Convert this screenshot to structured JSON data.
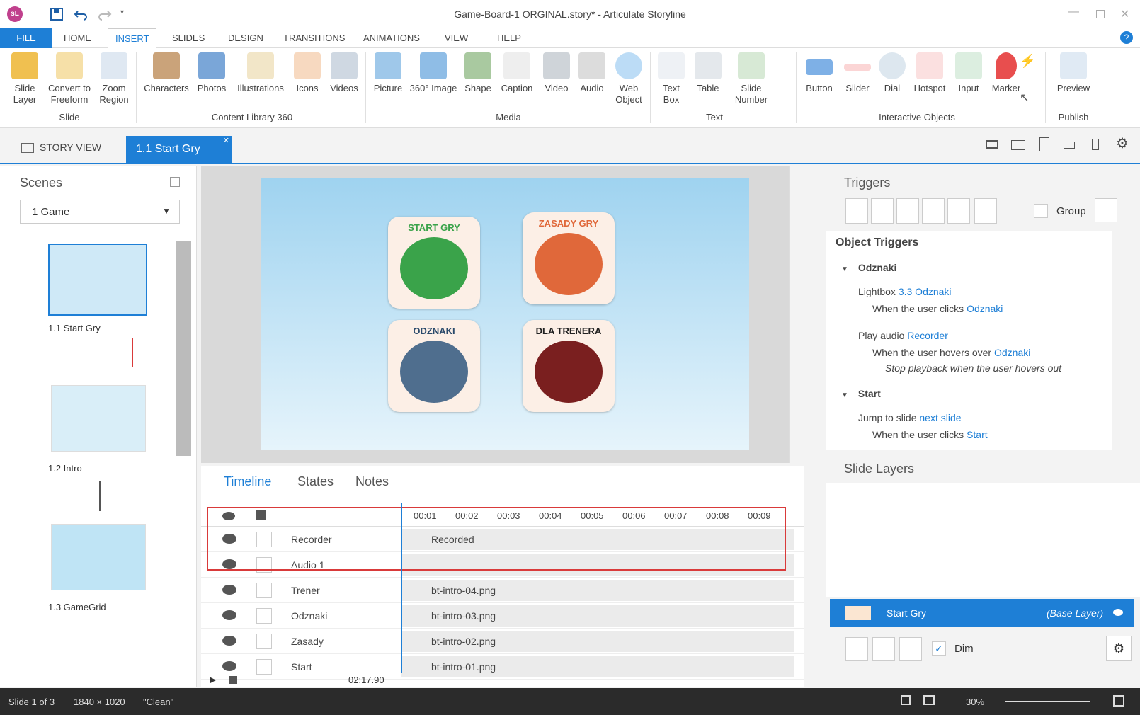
{
  "title": "Game-Board-1 ORGINAL.story* -  Articulate Storyline",
  "app_logo": "sL",
  "colors": {
    "accent": "#1e7fd6",
    "highlight_box": "#d93a3a"
  },
  "menu": {
    "file": "FILE",
    "items": [
      "HOME",
      "INSERT",
      "SLIDES",
      "DESIGN",
      "TRANSITIONS",
      "ANIMATIONS",
      "VIEW",
      "HELP"
    ],
    "active": "INSERT"
  },
  "ribbon": {
    "slide": {
      "layer": "Slide\nLayer",
      "freeform": "Convert to\nFreeform",
      "zoom": "Zoom\nRegion",
      "group": "Slide"
    },
    "library": {
      "characters": "Characters",
      "photos": "Photos",
      "illustrations": "Illustrations",
      "icons": "Icons",
      "videos": "Videos",
      "group": "Content Library 360"
    },
    "media": {
      "picture": "Picture",
      "image360": "360° Image",
      "shape": "Shape",
      "caption": "Caption",
      "video": "Video",
      "audio": "Audio",
      "web": "Web\nObject",
      "group": "Media"
    },
    "text": {
      "textbox": "Text\nBox",
      "table": "Table",
      "slidenumber": "Slide\nNumber",
      "group": "Text"
    },
    "interactive": {
      "button": "Button",
      "slider": "Slider",
      "dial": "Dial",
      "hotspot": "Hotspot",
      "input": "Input",
      "marker": "Marker",
      "group": "Interactive Objects"
    },
    "publish": {
      "preview": "Preview",
      "group": "Publish"
    }
  },
  "tabs": {
    "story_view": "STORY VIEW",
    "slide_tab": "1.1 Start Gry"
  },
  "scenes": {
    "title": "Scenes",
    "selector": "1 Game",
    "slides": [
      "1.1 Start Gry",
      "1.2 Intro",
      "1.3 GameGrid"
    ]
  },
  "slide_cards": [
    {
      "label": "START GRY",
      "color": "#3aa34a"
    },
    {
      "label": "ZASADY GRY",
      "color": "#e0683a"
    },
    {
      "label": "ODZNAKI",
      "color": "#2a4a6b"
    },
    {
      "label": "DLA TRENERA",
      "color": "#222222"
    }
  ],
  "timeline": {
    "tabs": [
      "Timeline",
      "States",
      "Notes"
    ],
    "ticks": [
      "00:01",
      "00:02",
      "00:03",
      "00:04",
      "00:05",
      "00:06",
      "00:07",
      "00:08",
      "00:09"
    ],
    "rows": [
      {
        "name": "Recorder",
        "bar": "Recorded"
      },
      {
        "name": "Audio 1",
        "bar": ""
      },
      {
        "name": "Trener",
        "bar": "bt-intro-04.png"
      },
      {
        "name": "Odznaki",
        "bar": "bt-intro-03.png"
      },
      {
        "name": "Zasady",
        "bar": "bt-intro-02.png"
      },
      {
        "name": "Start",
        "bar": "bt-intro-01.png"
      }
    ],
    "time": "02:17.90"
  },
  "triggers": {
    "title": "Triggers",
    "group_label": "Group",
    "object_triggers": "Object Triggers",
    "odznaki": {
      "header": "Odznaki",
      "t1_action": "Lightbox",
      "t1_target": "3.3 Odznaki",
      "t1_when": "When the user clicks",
      "t1_obj": "Odznaki",
      "t2_action": "Play audio",
      "t2_target": "Recorder",
      "t2_when": "When the user hovers over",
      "t2_obj": "Odznaki",
      "t2_note": "Stop playback when the user hovers out"
    },
    "start": {
      "header": "Start",
      "action": "Jump to slide",
      "target": "next slide",
      "when": "When the user clicks",
      "obj": "Start"
    }
  },
  "layers": {
    "title": "Slide Layers",
    "base_name": "Start Gry",
    "base_tag": "(Base Layer)",
    "dim": "Dim"
  },
  "status": {
    "slide": "Slide 1 of 3",
    "size": "1840 × 1020",
    "theme": "\"Clean\"",
    "zoom": "30%"
  }
}
